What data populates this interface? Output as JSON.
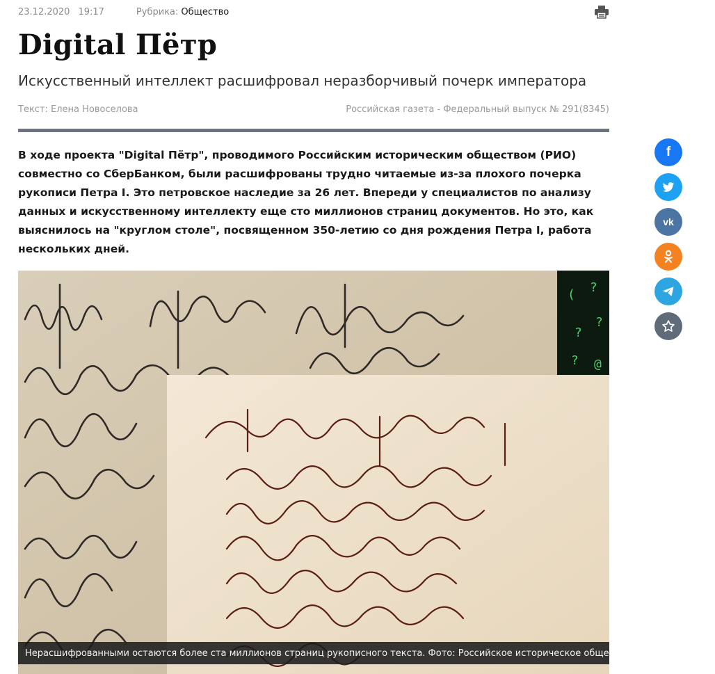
{
  "meta": {
    "date": "23.12.2020",
    "time": "19:17",
    "rubric_label": "Рубрика:",
    "rubric_value": "Общество"
  },
  "article": {
    "title": "Digital Пётр",
    "subtitle": "Искусственный интеллект расшифровал неразборчивый почерк императора",
    "author": "Текст: Елена Новоселова",
    "issue": "Российская газета - Федеральный выпуск № 291(8345)",
    "lead": "В ходе проекта \"Digital Пётр\", проводимого Российским историческим обществом (РИО) совместно со СберБанком, были расшифрованы трудно читаемые из-за плохого почерка рукописи Петра I. Это петровское наследие за 26 лет. Впереди у специалистов по анализу данных и искусственному интеллекту еще сто миллионов страниц документов. Но это, как выяснилось на \"круглом столе\", посвященном 350-летию со дня рождения Петра I, работа нескольких дней.",
    "photo_caption": "Нерасшифрованными остаются более ста миллионов страниц рукописного текста. Фото: Российское историческое общество"
  },
  "share": {
    "buttons": [
      {
        "name": "facebook",
        "icon": "facebook-icon",
        "color": "#1877f2"
      },
      {
        "name": "twitter",
        "icon": "twitter-icon",
        "color": "#1da1f2"
      },
      {
        "name": "vk",
        "icon": "vk-icon",
        "color": "#4c75a3"
      },
      {
        "name": "odnoklassniki",
        "icon": "odnoklassniki-icon",
        "color": "#f58220"
      },
      {
        "name": "telegram",
        "icon": "telegram-icon",
        "color": "#2ca5e0"
      },
      {
        "name": "favorite",
        "icon": "star-icon",
        "color": "#5f6b78"
      }
    ]
  },
  "colors": {
    "divider": "#6b7480",
    "accent_text": "#1a1a1a"
  }
}
